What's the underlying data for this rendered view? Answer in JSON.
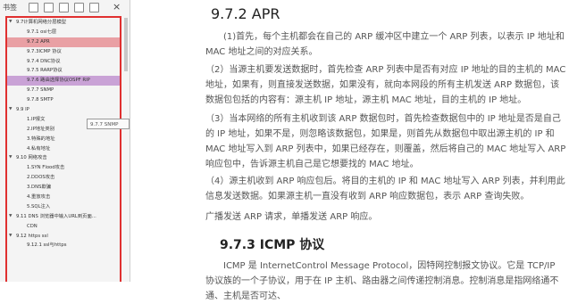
{
  "sidebar": {
    "title": "书签",
    "tooltip": "9.7.7 SNMP",
    "items": [
      {
        "label": "9.7计算机网络分层模型",
        "level": 1,
        "expanded": true
      },
      {
        "label": "9.7.1 osi七层",
        "level": 2
      },
      {
        "label": "9.7.2 APR",
        "level": 2,
        "selected": true
      },
      {
        "label": "9.7.3ICMP 协议",
        "level": 2
      },
      {
        "label": "9.7.4 DNC协议",
        "level": 2
      },
      {
        "label": "9.7.5 RARP协议",
        "level": 2
      },
      {
        "label": "9.7.6 路由选择协议OSPF RIP",
        "level": 2,
        "highlight": true
      },
      {
        "label": "9.7.7 SNMP",
        "level": 2
      },
      {
        "label": "9.7.8 SMTP",
        "level": 2
      },
      {
        "label": "9.9 IP",
        "level": 1,
        "expanded": true
      },
      {
        "label": "1.IP报文",
        "level": 2
      },
      {
        "label": "2.IP地址类别",
        "level": 2
      },
      {
        "label": "3.特殊的地址",
        "level": 2
      },
      {
        "label": "4.私有地址",
        "level": 2
      },
      {
        "label": "9.10 网络攻击",
        "level": 1,
        "expanded": true
      },
      {
        "label": "1.SYN Flood攻击",
        "level": 2
      },
      {
        "label": "2.DDOS攻击",
        "level": 2
      },
      {
        "label": "3.DNS欺骗",
        "level": 2
      },
      {
        "label": "4.重放攻击",
        "level": 2
      },
      {
        "label": "5.SQL注入",
        "level": 2
      },
      {
        "label": "9.11 DNS 浏览器中输入URL到页面...",
        "level": 1,
        "expanded": true
      },
      {
        "label": "CDN",
        "level": 2
      },
      {
        "label": "9.12 https ssl",
        "level": 1,
        "expanded": true
      },
      {
        "label": "9.12.1 ssl与https",
        "level": 2
      }
    ]
  },
  "document": {
    "heading1": "9.7.2 APR",
    "paragraphs": [
      "(1)首先，每个主机都会在自己的 ARP 缓冲区中建立一个 ARP 列表，以表示 IP 地址和 MAC 地址之间的对应关系。",
      "（2）当源主机要发送数据时，首先检查 ARP 列表中是否有对应 IP 地址的目的主机的 MAC 地址，如果有，则直接发送数据，如果没有，就向本网段的所有主机发送 ARP 数据包，该数据包包括的内容有：源主机 IP 地址，源主机 MAC 地址，目的主机的 IP 地址。",
      "（3）当本网络的所有主机收到该 ARP 数据包时，首先检查数据包中的 IP 地址是否是自己的 IP 地址，如果不是，则忽略该数据包，如果是，则首先从数据包中取出源主机的 IP 和 MAC 地址写入到 ARP 列表中，如果已经存在，则覆盖，然后将自己的 MAC 地址写入 ARP 响应包中，告诉源主机自己是它想要找的 MAC 地址。",
      "（4）源主机收到 ARP 响应包后。将目的主机的 IP 和 MAC 地址写入 ARP 列表，并利用此信息发送数据。如果源主机一直没有收到 ARP 响应数据包，表示 ARP 查询失败。",
      "广播发送 ARP 请求，单播发送 ARP 响应。"
    ],
    "heading2": "9.7.3 ICMP 协议",
    "paragraph_last": "ICMP 是 InternetControl Message Protocol，因特网控制报文协议。它是 TCP/IP 协议族的一个子协议，用于在 IP 主机、路由器之间传递控制消息。控制消息是指网络通不通、主机是否可达、"
  }
}
